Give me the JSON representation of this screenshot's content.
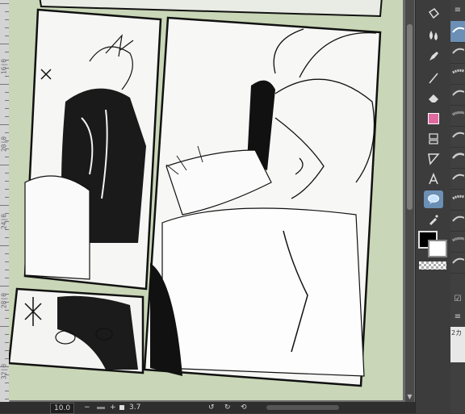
{
  "ruler": {
    "labels": [
      "16|0",
      "20|0",
      "24|0",
      "28|0",
      "32|0"
    ]
  },
  "status": {
    "zoom": "10.0",
    "minus": "−",
    "plus": "+",
    "angle": "3.7",
    "rotate_left": "↺",
    "rotate_right": "↻",
    "reset": "⟲"
  },
  "tools": [
    {
      "name": "fill-bucket-icon",
      "active": false
    },
    {
      "name": "blend-drops-icon",
      "active": false
    },
    {
      "name": "pen-icon",
      "active": false
    },
    {
      "name": "line-icon",
      "active": false
    },
    {
      "name": "eraser-icon",
      "active": false
    },
    {
      "name": "gradient-icon",
      "active": false
    },
    {
      "name": "frame-border-icon",
      "active": false
    },
    {
      "name": "ruler-triangle-icon",
      "active": false
    },
    {
      "name": "text-tool-icon",
      "active": false
    },
    {
      "name": "balloon-icon",
      "active": true
    },
    {
      "name": "eyedropper-icon",
      "active": false
    }
  ],
  "colors": {
    "main": "#000000",
    "sub": "#ffffff",
    "accent": "#6b8fb5",
    "paper": "#c9d6b7"
  },
  "layer": {
    "label": "2カ"
  }
}
